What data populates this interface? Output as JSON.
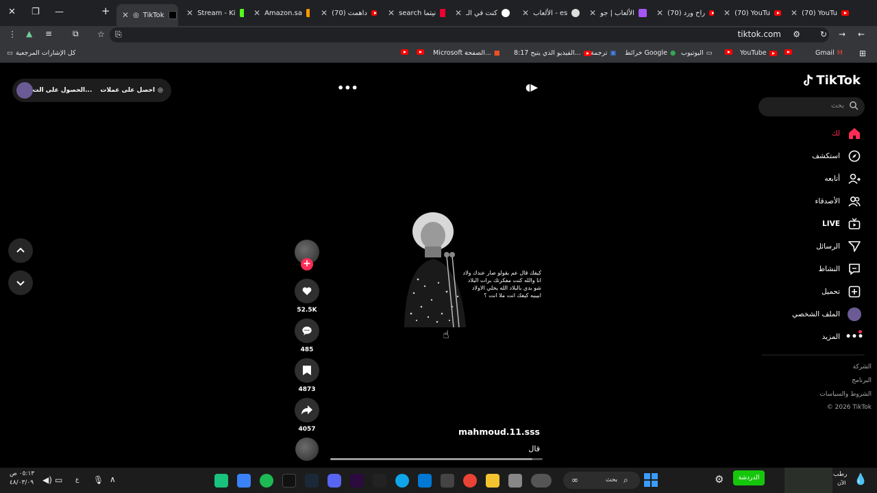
{
  "browser": {
    "tabs": [
      {
        "label": "TikTok",
        "active": true
      },
      {
        "label": "Stream - Ki"
      },
      {
        "label": "Amazon.sa"
      },
      {
        "label": "(70) داهمت"
      },
      {
        "label": "search نيتما"
      },
      {
        "label": "كنت في الـ"
      },
      {
        "label": "الألعاب - es"
      },
      {
        "label": "الألعاب | جو"
      },
      {
        "label": "(70) راح ورد"
      },
      {
        "label": "(70) YouTu"
      },
      {
        "label": "(70) YouTu"
      }
    ],
    "url": "tiktok.com",
    "bookmarks": [
      {
        "label": "Gmail"
      },
      {
        "label": ""
      },
      {
        "label": "YouTube"
      },
      {
        "label": ""
      },
      {
        "label": "اليوتيوب"
      },
      {
        "label": "خرائط Google"
      },
      {
        "label": "ترجمة"
      },
      {
        "label": "8:17 الفيديو الذي يتيح..."
      },
      {
        "label": "الصفحة..."
      },
      {
        "label": "Microsoft –"
      },
      {
        "label": ""
      },
      {
        "label": ""
      }
    ],
    "all_bookmarks_label": "كل الإشارات المرجعية"
  },
  "tiktok": {
    "logo_text": "TikTok",
    "search_placeholder": "بحث",
    "nav": [
      {
        "label": "لك",
        "icon": "home-icon",
        "active": true
      },
      {
        "label": "استكشف",
        "icon": "compass-icon"
      },
      {
        "label": "أتابعه",
        "icon": "following-icon"
      },
      {
        "label": "الأصدقاء",
        "icon": "friends-icon"
      },
      {
        "label": "LIVE",
        "icon": "live-icon"
      },
      {
        "label": "الرسائل",
        "icon": "messages-icon"
      },
      {
        "label": "النشاط",
        "icon": "activity-icon"
      },
      {
        "label": "تحميل",
        "icon": "upload-icon"
      },
      {
        "label": "الملف الشخصي",
        "icon": "profile-avatar"
      },
      {
        "label": "المزيد",
        "icon": "more-icon"
      }
    ],
    "footer": [
      "الشركة",
      "البرنامج",
      "الشروط والسياسات",
      "© 2026 TikTok"
    ],
    "top_buttons": {
      "coins": "احصل على عملات",
      "app": "الحصول على الت..."
    },
    "video": {
      "quote_lines": [
        "كيفك قال عم بقولو صار عندك ولاد",
        "انا والله كنت مفكرتك برات البلاد",
        "شو بدي بالبلاد الله يخلي الاولاد",
        "ابيبيه كيفك انت ملا انت ؟"
      ],
      "username": "mahmoud.11.sss",
      "caption": "قال",
      "progress": 0.95
    },
    "actions": {
      "likes": "52.5K",
      "comments": "485",
      "saves": "4873",
      "shares": "4057"
    }
  },
  "taskbar": {
    "weather": "رطب",
    "weather_sub": "الآن",
    "time": "٠٥:١٣ ص",
    "date": "٤٨/٠٣/٠٩",
    "lang": "ع",
    "search_label": "بحث",
    "chat_label": "الدردشة"
  }
}
